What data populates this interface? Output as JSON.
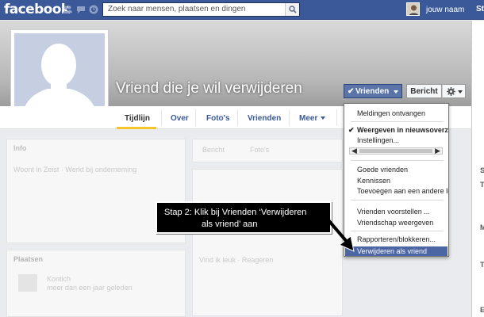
{
  "topbar": {
    "logo": "facebook",
    "search_placeholder": "Zoek naar mensen, plaatsen en dingen",
    "user_name": "jouw naam",
    "right_cut": "St",
    "icons": [
      "friend-requests-icon",
      "messages-icon",
      "notifications-icon",
      "search-icon"
    ]
  },
  "profile": {
    "name": "Vriend die je wil verwijderen",
    "friends_button": "Vrienden",
    "message_button": "Bericht",
    "colors": {
      "fb_blue": "#3b5998",
      "button_blue": "#5b74a8",
      "highlight": "#4c66a4",
      "tab_active": "#f5c52a"
    }
  },
  "tabs": [
    "Tijdlijn",
    "Over",
    "Foto's",
    "Vrienden",
    "Meer"
  ],
  "dropdown": {
    "items": [
      "Meldingen ontvangen",
      "Weergeven in nieuwsoverzicht",
      "Instellingen...",
      "Goede vrienden",
      "Kennissen",
      "Toevoegen aan een andere lijst...",
      "Vrienden voorstellen ...",
      "Vriendschap weergeven",
      "Rapporteren/blokkeren...",
      "Verwijderen als vriend"
    ],
    "checked": "Weergeven in nieuwsoverzicht",
    "highlighted": "Verwijderen als vriend"
  },
  "faded": {
    "card1_title": "Info",
    "card1_line": "Woont in Zeist · Werkt bij onderneming",
    "card2_a": "Bericht",
    "card2_b": "Foto's",
    "places_title": "Plaatsen",
    "places_line1": "Kontich",
    "places_line2": "meer dan een jaar geleden",
    "like_line": "Vind ik leuk · Reageren"
  },
  "callout": {
    "line1": "Stap 2: Klik bij Vrienden ‘Verwijderen",
    "line2": "als vriend’ aan"
  },
  "right_edge": [
    "S",
    "T",
    "M",
    "T",
    "E",
    "S"
  ]
}
